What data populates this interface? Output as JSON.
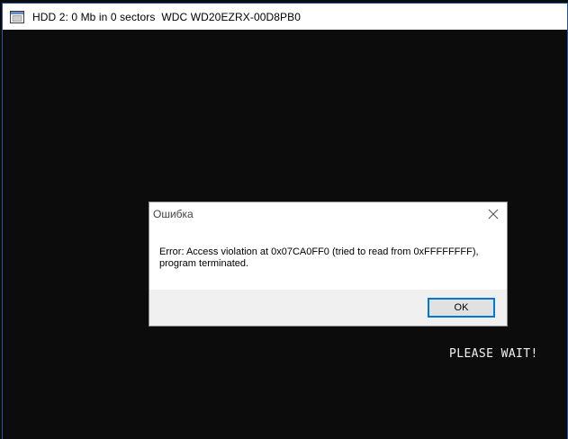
{
  "window": {
    "title": "HDD 2: 0 Mb in 0 sectors  WDC WD20EZRX-00D8PB0",
    "icon": "console-app-icon"
  },
  "console": {
    "status_text": "PLEASE WAIT!"
  },
  "dialog": {
    "title": "Ошибка",
    "message": "Error: Access violation at 0x07CA0FF0 (tried to read from 0xFFFFFFFF), program terminated.",
    "ok_label": "OK"
  },
  "colors": {
    "console_bg": "#0c0c0c",
    "window_border": "#2b5797",
    "button_focus": "#0078d7"
  }
}
